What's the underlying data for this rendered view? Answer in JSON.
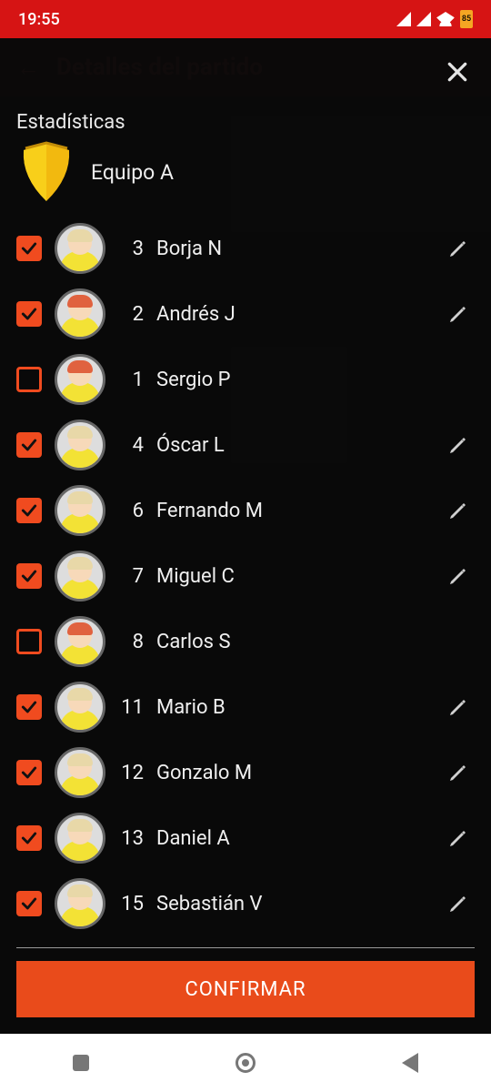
{
  "status": {
    "time": "19:55",
    "battery": "85"
  },
  "background_header": {
    "title": "Detalles del partido"
  },
  "modal": {
    "title": "Estadísticas",
    "team_name": "Equipo A",
    "confirm_label": "CONFIRMAR",
    "players": [
      {
        "number": "3",
        "name": "Borja N",
        "checked": true,
        "editable": true,
        "hair": "#e8d8a8"
      },
      {
        "number": "2",
        "name": "Andrés J",
        "checked": true,
        "editable": true,
        "hair": "#e0623f"
      },
      {
        "number": "1",
        "name": "Sergio P",
        "checked": false,
        "editable": false,
        "hair": "#e0623f"
      },
      {
        "number": "4",
        "name": "Óscar L",
        "checked": true,
        "editable": true,
        "hair": "#e8d8a8"
      },
      {
        "number": "6",
        "name": "Fernando M",
        "checked": true,
        "editable": true,
        "hair": "#e8d8a8"
      },
      {
        "number": "7",
        "name": "Miguel C",
        "checked": true,
        "editable": true,
        "hair": "#e8d8a8"
      },
      {
        "number": "8",
        "name": "Carlos S",
        "checked": false,
        "editable": false,
        "hair": "#e0623f"
      },
      {
        "number": "11",
        "name": "Mario B",
        "checked": true,
        "editable": true,
        "hair": "#e8d8a8"
      },
      {
        "number": "12",
        "name": "Gonzalo M",
        "checked": true,
        "editable": true,
        "hair": "#e8d8a8"
      },
      {
        "number": "13",
        "name": "Daniel A",
        "checked": true,
        "editable": true,
        "hair": "#e8d8a8"
      },
      {
        "number": "15",
        "name": "Sebastián V",
        "checked": true,
        "editable": true,
        "hair": "#e8d8a8"
      }
    ]
  }
}
